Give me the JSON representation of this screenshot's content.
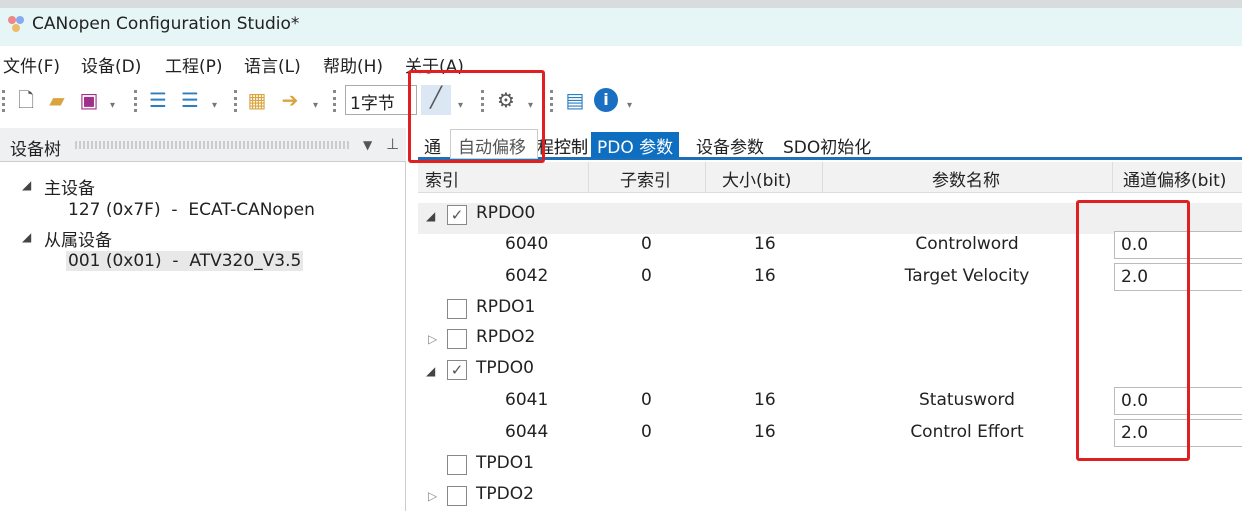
{
  "window": {
    "title": "CANopen Configuration Studio*"
  },
  "menu": [
    "文件(F)",
    "设备(D)",
    "工程(P)",
    "语言(L)",
    "帮助(H)",
    "关于(A)"
  ],
  "toolbar": {
    "combo_value": "1字节",
    "tooltip": "自动偏移",
    "icons": [
      "new-file-icon",
      "open-folder-icon",
      "save-icon",
      "add-node-icon",
      "remove-node-icon",
      "package-icon",
      "export-icon",
      "magic-wand-icon",
      "settings-gears-icon",
      "help-doc-icon",
      "info-icon"
    ]
  },
  "left_panel": {
    "title": "设备树",
    "tree": {
      "master_label": "主设备",
      "master_device": "127 (0x7F)  -  ECAT-CANopen",
      "slave_label": "从属设备",
      "slave_device": "001 (0x01)  -  ATV320_V3.5"
    }
  },
  "tabs": [
    "通用",
    "过程控制",
    "PDO 参数",
    "设备参数",
    "SDO初始化"
  ],
  "tabs_visible": {
    "t0": "通",
    "t1": "控制"
  },
  "table": {
    "headers": [
      "索引",
      "子索引",
      "大小(bit)",
      "参数名称",
      "通道偏移(bit)"
    ],
    "rows": [
      {
        "type": "group",
        "label": "RPDO0",
        "checked": true,
        "expanded": true
      },
      {
        "type": "item",
        "index": "6040",
        "sub": "0",
        "size": "16",
        "name": "Controlword",
        "offset": "0.0"
      },
      {
        "type": "item",
        "index": "6042",
        "sub": "0",
        "size": "16",
        "name": "Target Velocity",
        "offset": "2.0"
      },
      {
        "type": "group",
        "label": "RPDO1",
        "checked": false
      },
      {
        "type": "group",
        "label": "RPDO2",
        "checked": false,
        "collapsed": true
      },
      {
        "type": "group",
        "label": "TPDO0",
        "checked": true,
        "expanded": true
      },
      {
        "type": "item",
        "index": "6041",
        "sub": "0",
        "size": "16",
        "name": "Statusword",
        "offset": "0.0"
      },
      {
        "type": "item",
        "index": "6044",
        "sub": "0",
        "size": "16",
        "name": "Control Effort",
        "offset": "2.0"
      },
      {
        "type": "group",
        "label": "TPDO1",
        "checked": false
      },
      {
        "type": "group",
        "label": "TPDO2",
        "checked": false,
        "collapsed": true
      }
    ]
  },
  "colors": {
    "accent": "#0e6fc1",
    "highlight": "#e02020"
  }
}
